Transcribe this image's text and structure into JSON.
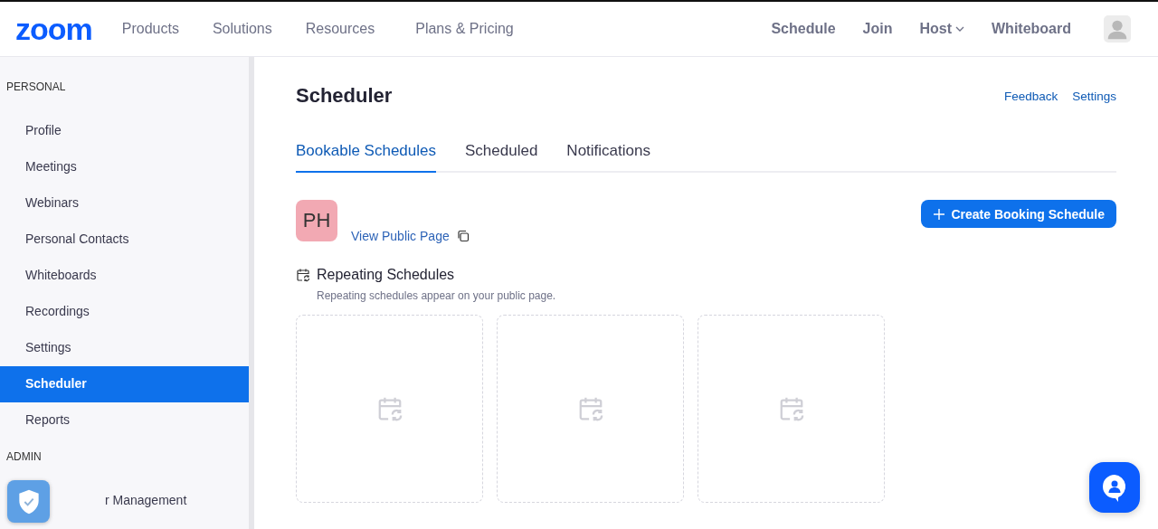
{
  "header": {
    "logo": "zoom",
    "nav": [
      {
        "label": "Products"
      },
      {
        "label": "Solutions"
      },
      {
        "label": "Resources"
      },
      {
        "label": "Plans & Pricing"
      }
    ],
    "actions": [
      {
        "label": "Schedule",
        "dropdown": false
      },
      {
        "label": "Join",
        "dropdown": false
      },
      {
        "label": "Host",
        "dropdown": true
      },
      {
        "label": "Whiteboard",
        "dropdown": false
      }
    ]
  },
  "sidebar": {
    "sections": [
      {
        "title": "PERSONAL",
        "items": [
          {
            "label": "Profile",
            "selected": false
          },
          {
            "label": "Meetings",
            "selected": false
          },
          {
            "label": "Webinars",
            "selected": false
          },
          {
            "label": "Personal Contacts",
            "selected": false
          },
          {
            "label": "Whiteboards",
            "selected": false
          },
          {
            "label": "Recordings",
            "selected": false
          },
          {
            "label": "Settings",
            "selected": false
          },
          {
            "label": "Scheduler",
            "selected": true
          },
          {
            "label": "Reports",
            "selected": false
          }
        ]
      },
      {
        "title": "ADMIN",
        "items": [
          {
            "label": "r Management",
            "selected": false
          }
        ]
      }
    ]
  },
  "page": {
    "title": "Scheduler",
    "links": [
      "Feedback",
      "Settings"
    ],
    "tabs": [
      {
        "label": "Bookable Schedules",
        "selected": true
      },
      {
        "label": "Scheduled",
        "selected": false
      },
      {
        "label": "Notifications",
        "selected": false
      }
    ],
    "profile": {
      "initials": "PH",
      "link": "View Public Page"
    },
    "create_button": "Create Booking Schedule",
    "section": {
      "title": "Repeating Schedules",
      "subtitle": "Repeating schedules appear on your public page.",
      "cards": [
        {
          "kind": "placeholder"
        },
        {
          "kind": "placeholder"
        },
        {
          "kind": "placeholder"
        }
      ]
    }
  }
}
